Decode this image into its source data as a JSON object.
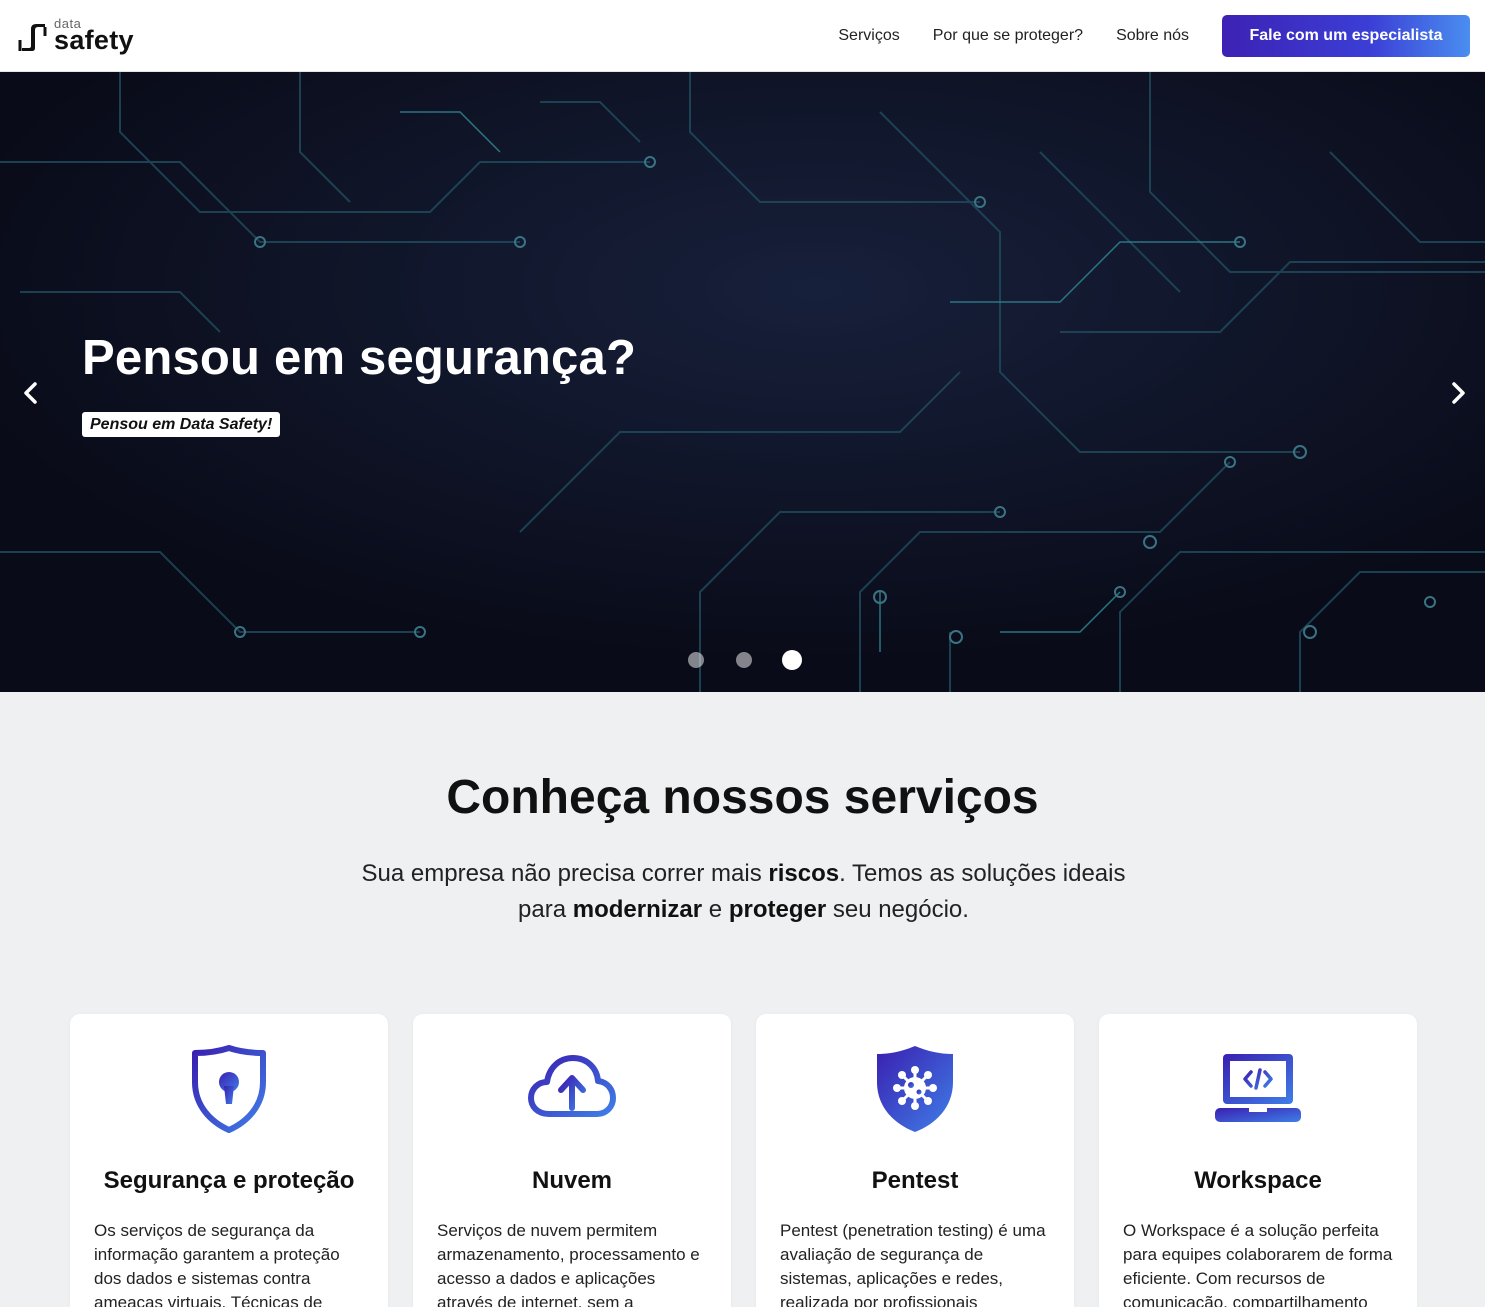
{
  "header": {
    "logo_small": "data",
    "logo_big": "safety",
    "nav": [
      "Serviços",
      "Por que se proteger?",
      "Sobre nós"
    ],
    "cta": "Fale com um especialista"
  },
  "hero": {
    "title": "Pensou em segurança?",
    "tag": "Pensou em Data Safety!",
    "slides": 3,
    "active_slide": 3
  },
  "services": {
    "title": "Conheça nossos serviços",
    "subtitle": {
      "p1": "Sua empresa não precisa correr mais ",
      "b1": "riscos",
      "p2": ". Temos as soluções ideais para ",
      "b2": "modernizar",
      "p3": " e ",
      "b3": "proteger",
      "p4": " seu negócio."
    },
    "cards": [
      {
        "icon": "shield-keyhole-icon",
        "title": "Segurança e proteção",
        "text": "Os serviços de segurança da informação garantem a proteção dos dados e sistemas contra ameaças virtuais. Técnicas de"
      },
      {
        "icon": "cloud-upload-icon",
        "title": "Nuvem",
        "text": "Serviços de nuvem permitem armazenamento, processamento e acesso a dados e aplicações através de internet, sem a"
      },
      {
        "icon": "shield-virus-icon",
        "title": "Pentest",
        "text": "Pentest (penetration testing) é uma avaliação de segurança de sistemas, aplicações e redes, realizada por profissionais"
      },
      {
        "icon": "laptop-code-icon",
        "title": "Workspace",
        "text": "O Workspace é a solução perfeita para equipes colaborarem de forma eficiente. Com recursos de comunicação, compartilhamento"
      }
    ]
  },
  "colors": {
    "brand_gradient_start": "#3d21b4",
    "brand_gradient_end": "#4a8ef0",
    "hero_bg": "#0b0d1d",
    "section_bg": "#eef0f2"
  }
}
